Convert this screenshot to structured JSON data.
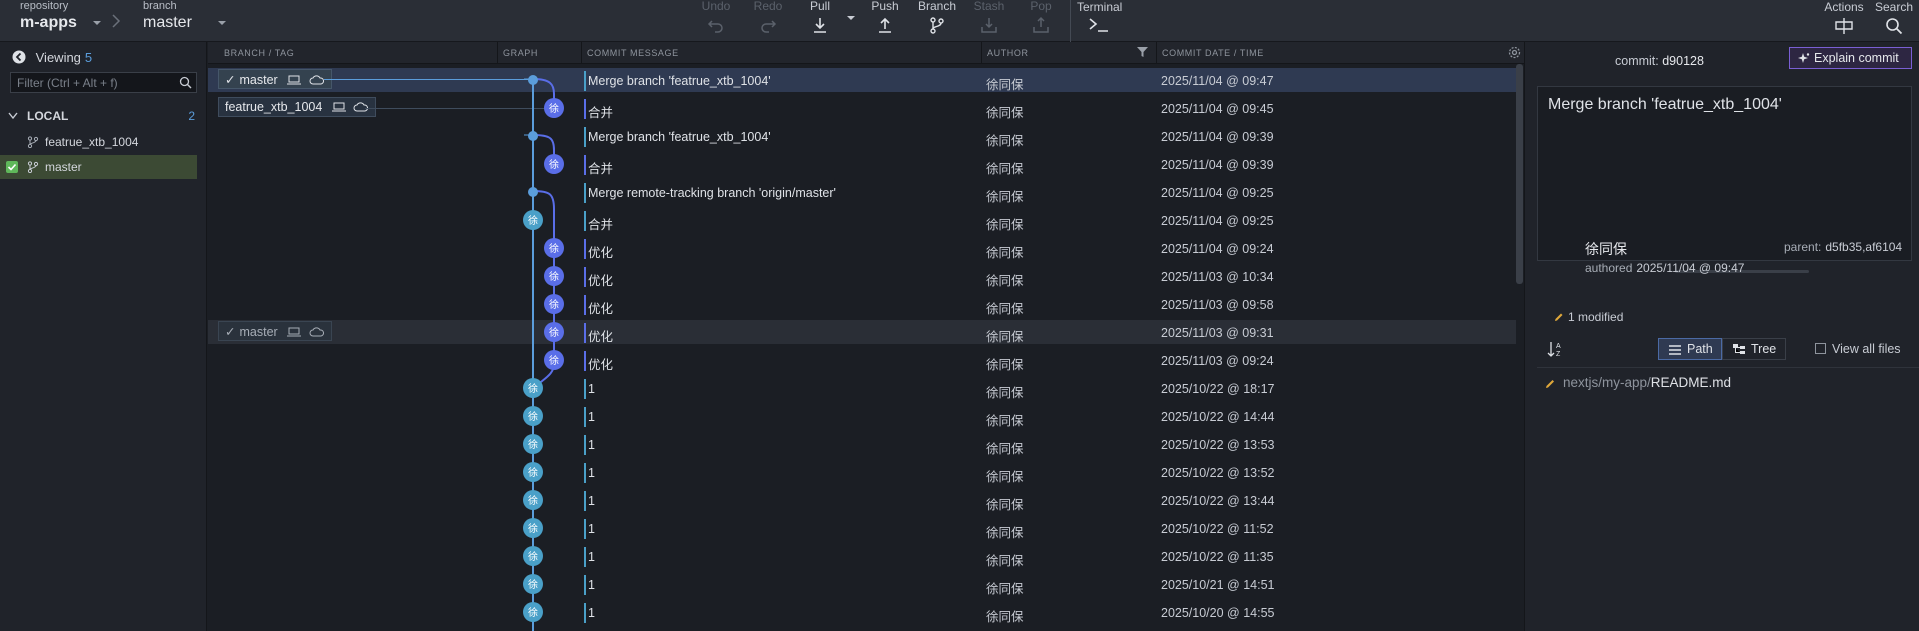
{
  "toolbar": {
    "repository_label": "repository",
    "repository_name": "m-apps",
    "branch_label": "branch",
    "branch_name": "master",
    "undo": "Undo",
    "redo": "Redo",
    "pull": "Pull",
    "push": "Push",
    "branch": "Branch",
    "stash": "Stash",
    "pop": "Pop",
    "terminal": "Terminal",
    "actions": "Actions",
    "search": "Search"
  },
  "left_panel": {
    "viewing_label": "Viewing",
    "viewing_count": "5",
    "filter_placeholder": "Filter (Ctrl + Alt + f)",
    "local_label": "LOCAL",
    "local_count": "2",
    "branches": [
      "featrue_xtb_1004",
      "master"
    ]
  },
  "columns": {
    "branch_tag": "BRANCH / TAG",
    "graph": "GRAPH",
    "message": "COMMIT MESSAGE",
    "author": "AUTHOR",
    "date": "COMMIT DATE / TIME"
  },
  "tags": {
    "master": "master",
    "feature": "featrue_xtb_1004",
    "remote_master": "master"
  },
  "avatar_char": "徐",
  "commits": [
    {
      "message": "Merge branch 'featrue_xtb_1004'",
      "author": "徐同保",
      "date": "2025/11/04 @ 09:47"
    },
    {
      "message": "合并",
      "author": "徐同保",
      "date": "2025/11/04 @ 09:45"
    },
    {
      "message": "Merge branch 'featrue_xtb_1004'",
      "author": "徐同保",
      "date": "2025/11/04 @ 09:39"
    },
    {
      "message": "合并",
      "author": "徐同保",
      "date": "2025/11/04 @ 09:39"
    },
    {
      "message": "Merge remote-tracking branch 'origin/master'",
      "author": "徐同保",
      "date": "2025/11/04 @ 09:25"
    },
    {
      "message": "合并",
      "author": "徐同保",
      "date": "2025/11/04 @ 09:25"
    },
    {
      "message": "优化",
      "author": "徐同保",
      "date": "2025/11/04 @ 09:24"
    },
    {
      "message": "优化",
      "author": "徐同保",
      "date": "2025/11/03 @ 10:34"
    },
    {
      "message": "优化",
      "author": "徐同保",
      "date": "2025/11/03 @ 09:58"
    },
    {
      "message": "优化",
      "author": "徐同保",
      "date": "2025/11/03 @ 09:31"
    },
    {
      "message": "优化",
      "author": "徐同保",
      "date": "2025/11/03 @ 09:24"
    },
    {
      "message": "1",
      "author": "徐同保",
      "date": "2025/10/22 @ 18:17"
    },
    {
      "message": "1",
      "author": "徐同保",
      "date": "2025/10/22 @ 14:44"
    },
    {
      "message": "1",
      "author": "徐同保",
      "date": "2025/10/22 @ 13:53"
    },
    {
      "message": "1",
      "author": "徐同保",
      "date": "2025/10/22 @ 13:52"
    },
    {
      "message": "1",
      "author": "徐同保",
      "date": "2025/10/22 @ 13:44"
    },
    {
      "message": "1",
      "author": "徐同保",
      "date": "2025/10/22 @ 11:52"
    },
    {
      "message": "1",
      "author": "徐同保",
      "date": "2025/10/22 @ 11:35"
    },
    {
      "message": "1",
      "author": "徐同保",
      "date": "2025/10/21 @ 14:51"
    },
    {
      "message": "1",
      "author": "徐同保",
      "date": "2025/10/20 @ 14:55"
    }
  ],
  "details": {
    "commit_label": "commit:",
    "commit_sha": "d90128",
    "explain_label": "Explain commit",
    "message": "Merge branch 'featrue_xtb_1004'",
    "author": "徐同保",
    "authored_label": "authored",
    "authored_date": "2025/11/04 @ 09:47",
    "parent_label": "parent:",
    "parent_shas": "d5fb35,af6104",
    "modified": "1 modified",
    "path_label": "Path",
    "tree_label": "Tree",
    "view_all": "View all files",
    "file_dir": "nextjs/my-app/",
    "file_name": "README.md"
  },
  "colors": {
    "accent_blue": "#5b9ddb",
    "node_purple": "#5a6ee8",
    "node_teal": "#4aa0c8",
    "explain_border": "#7a5fd4",
    "active_branch": "#3c4a34"
  }
}
